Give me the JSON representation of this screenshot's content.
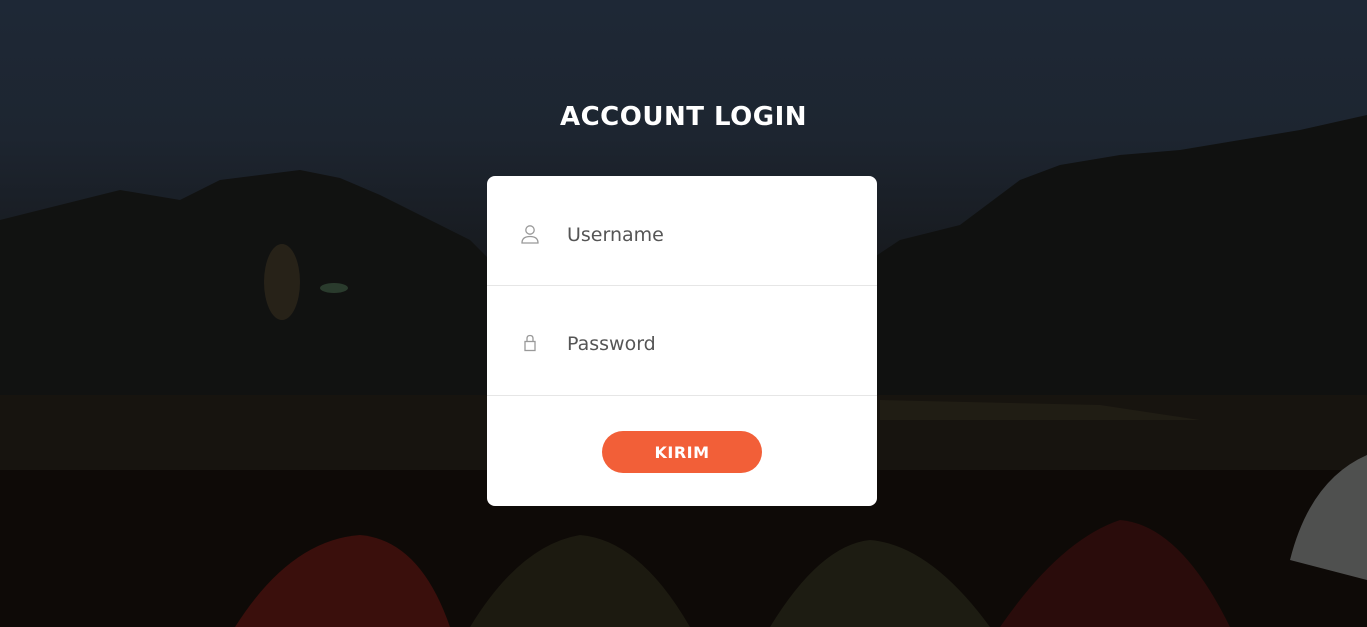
{
  "page": {
    "title": "ACCOUNT LOGIN"
  },
  "form": {
    "username_placeholder": "Username",
    "username_value": "",
    "username_icon": "user-icon",
    "password_placeholder": "Password",
    "password_value": "",
    "password_icon": "lock-icon",
    "submit_label": "KIRIM"
  },
  "colors": {
    "accent": "#f25f38",
    "card": "#ffffff",
    "text": "#555555"
  }
}
